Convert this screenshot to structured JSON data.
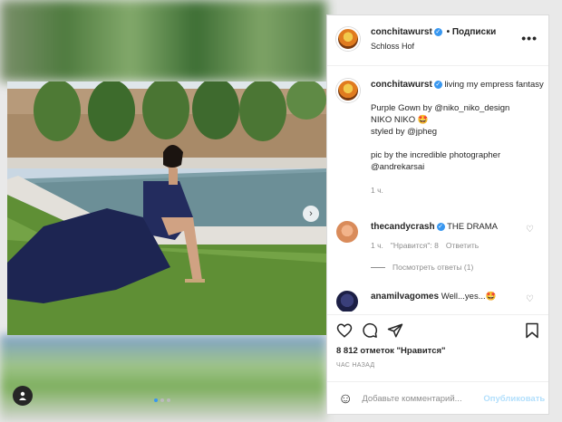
{
  "post": {
    "username": "conchitawurst",
    "follow_label": "• Подписки",
    "location": "Schloss Hof",
    "more_label": "•••",
    "caption_lines": {
      "first": "living my empress fantasy",
      "gown": "Purple Gown by @niko_niko_design",
      "brand": "NIKO NIKO 🤩",
      "styled": "styled by @jpheg",
      "pic": "pic by the incredible photographer",
      "photographer": "@andrekarsai"
    },
    "caption_time": "1 ч."
  },
  "comments": [
    {
      "username": "thecandycrash",
      "text": "THE DRAMA",
      "time": "1 ч.",
      "likes": "\"Нравится\": 8",
      "reply": "Ответить",
      "view_replies": "Посмотреть ответы (1)"
    },
    {
      "username": "anamilvagomes",
      "text": "Well...yes...🤩"
    }
  ],
  "footer": {
    "likes": "8 812 отметок \"Нравится\"",
    "time": "ЧАС НАЗАД",
    "comment_placeholder": "Добавьте комментарий...",
    "publish": "Опубликовать"
  },
  "icons": {
    "next": "chevron-right-icon",
    "heart": "heart-icon",
    "comment": "comment-icon",
    "share": "share-icon",
    "bookmark": "bookmark-icon",
    "emoji": "emoji-icon"
  },
  "colors": {
    "verified": "#3897f0",
    "publish_disabled": "#b2dffc",
    "meta_gray": "#8e8e8e"
  }
}
